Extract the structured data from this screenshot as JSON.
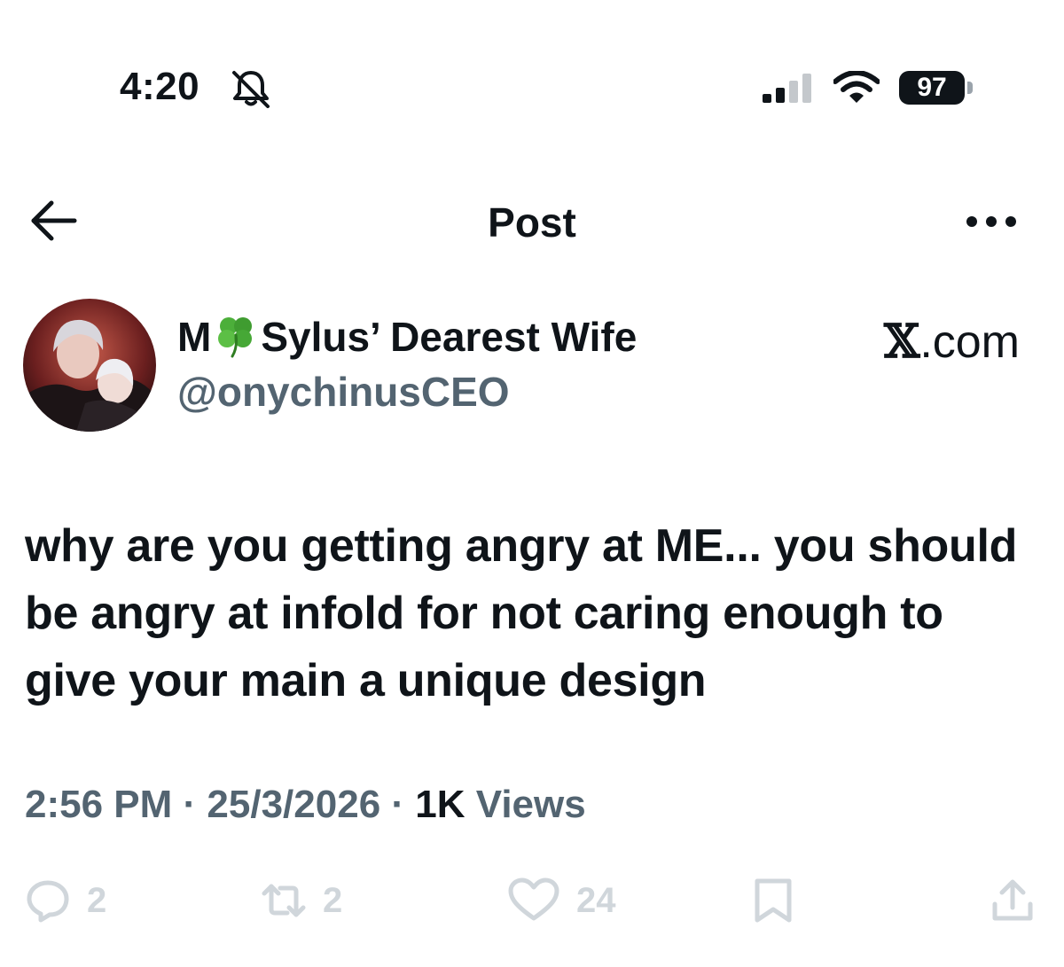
{
  "status_bar": {
    "time": "4:20",
    "battery": "97"
  },
  "header": {
    "title": "Post"
  },
  "post": {
    "display_name_before": "M",
    "display_name_after": "Sylus’ Dearest Wife",
    "handle": "@onychinusCEO",
    "source_label_prefix": "𝕏",
    "source_label_suffix": ".com",
    "text": "why are you getting angry at ME... you should be angry at infold for not caring enough to give your main a unique design",
    "time": "2:56 PM",
    "date": "25/3/2026",
    "views_count": "1K",
    "views_label": "Views",
    "separator": "·"
  },
  "actions": {
    "replies": "2",
    "reposts": "2",
    "likes": "24"
  },
  "colors": {
    "text": "#0f1419",
    "secondary": "#536471",
    "action_icons": "#d0d6db"
  }
}
